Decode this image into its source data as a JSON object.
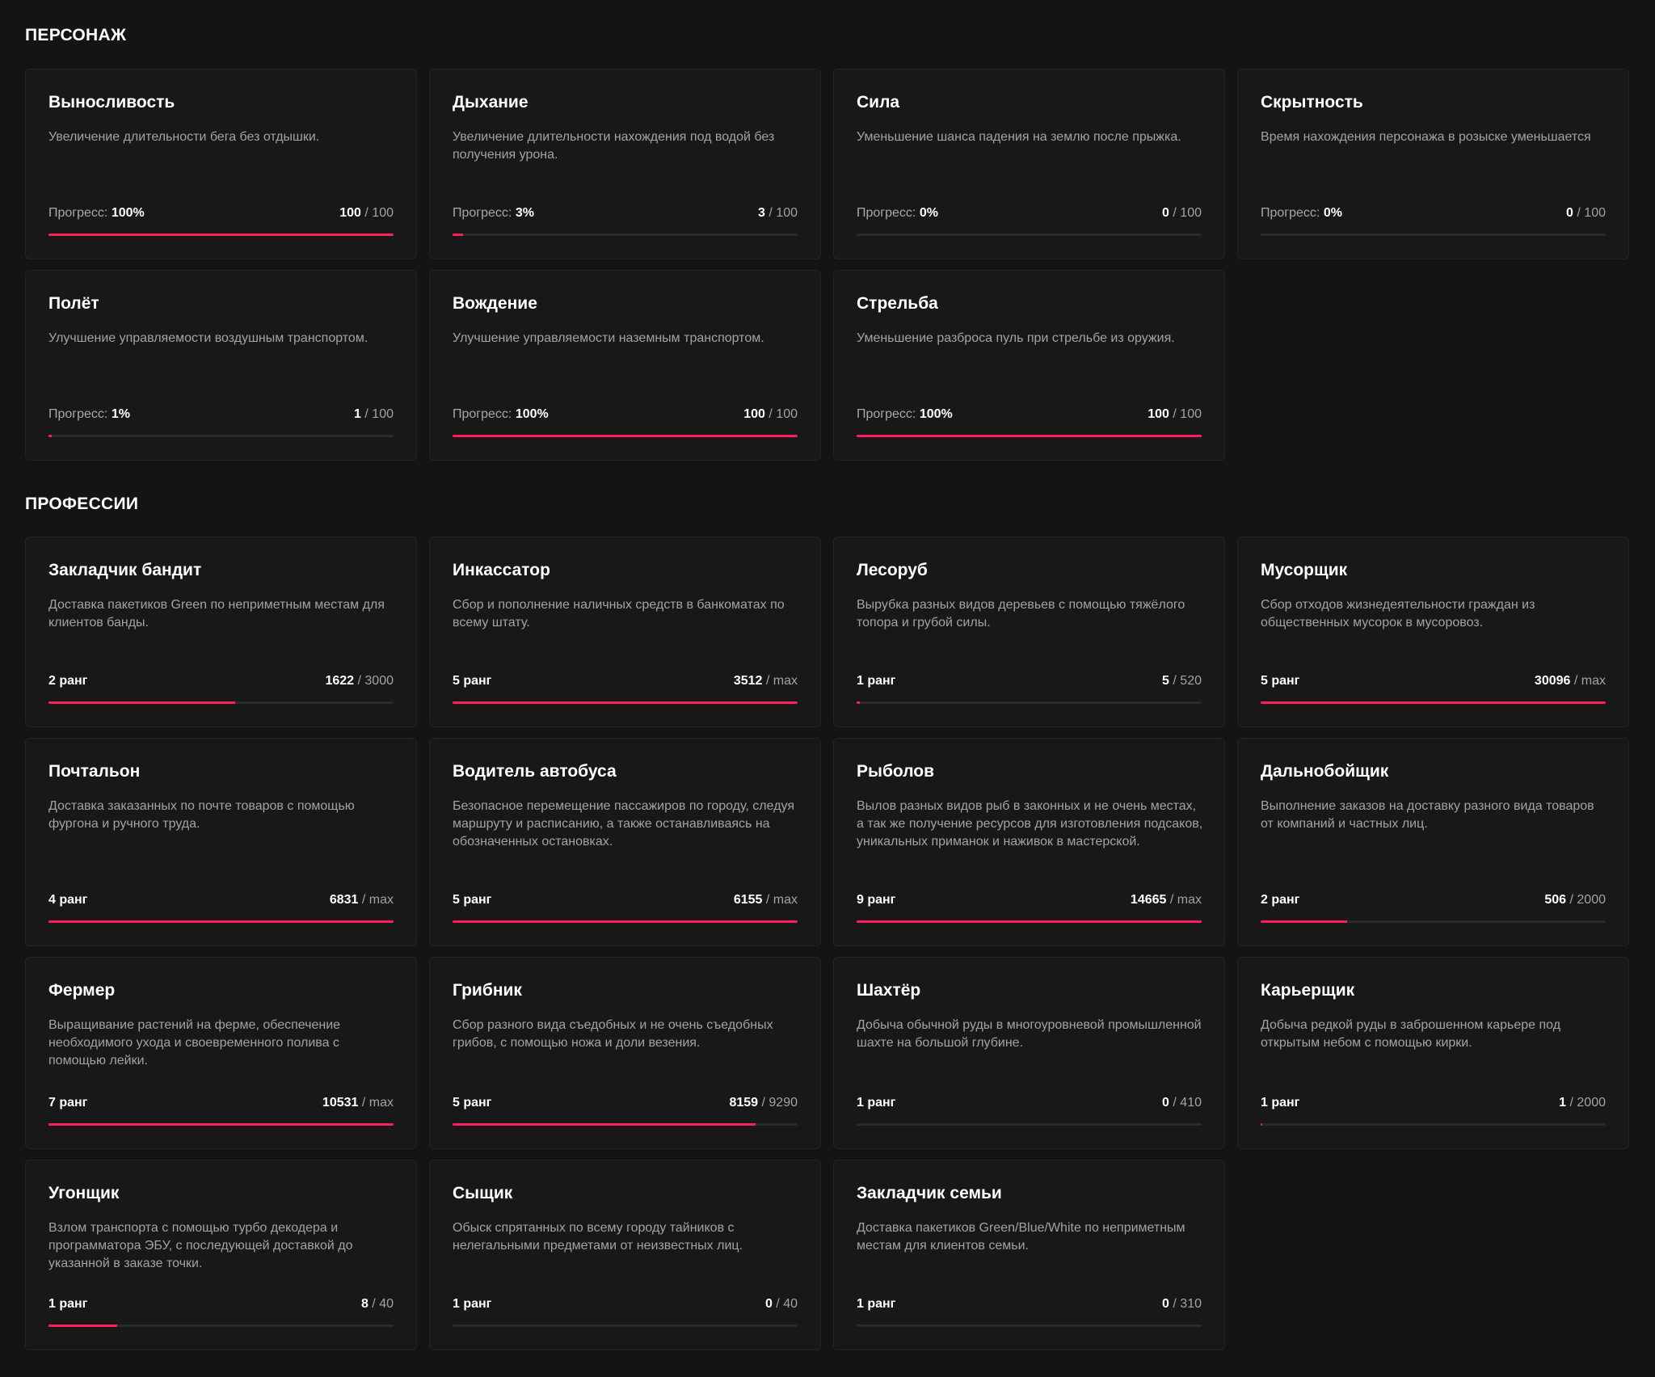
{
  "sections": [
    {
      "title": "ПЕРСОНАЖ",
      "cards": [
        {
          "title": "Выносливость",
          "desc": "Увеличение длительности бега без отдышки.",
          "label": "Прогресс:",
          "left_value": "100%",
          "current": "100",
          "total": "100",
          "fill": 1.0
        },
        {
          "title": "Дыхание",
          "desc": "Увеличение длительности нахождения под водой без получения урона.",
          "label": "Прогресс:",
          "left_value": "3%",
          "current": "3",
          "total": "100",
          "fill": 0.03
        },
        {
          "title": "Сила",
          "desc": "Уменьшение шанса падения на землю после прыжка.",
          "label": "Прогресс:",
          "left_value": "0%",
          "current": "0",
          "total": "100",
          "fill": 0
        },
        {
          "title": "Скрытность",
          "desc": "Время нахождения персонажа в розыске уменьшается",
          "label": "Прогресс:",
          "left_value": "0%",
          "current": "0",
          "total": "100",
          "fill": 0
        },
        {
          "title": "Полёт",
          "desc": "Улучшение управляемости воздушным транспортом.",
          "label": "Прогресс:",
          "left_value": "1%",
          "current": "1",
          "total": "100",
          "fill": 0.01
        },
        {
          "title": "Вождение",
          "desc": "Улучшение управляемости наземным транспортом.",
          "label": "Прогресс:",
          "left_value": "100%",
          "current": "100",
          "total": "100",
          "fill": 1.0
        },
        {
          "title": "Стрельба",
          "desc": "Уменьшение разброса пуль при стрельбе из оружия.",
          "label": "Прогресс:",
          "left_value": "100%",
          "current": "100",
          "total": "100",
          "fill": 1.0
        }
      ]
    },
    {
      "title": "ПРОФЕССИИ",
      "cards": [
        {
          "title": "Закладчик бандит",
          "desc": "Доставка пакетиков Green по неприметным местам для клиентов банды.",
          "label": "",
          "left_value": "2 ранг",
          "current": "1622",
          "total": "3000",
          "fill": 0.54
        },
        {
          "title": "Инкассатор",
          "desc": "Сбор и пополнение наличных средств в банкоматах по всему штату.",
          "label": "",
          "left_value": "5 ранг",
          "current": "3512",
          "total": "max",
          "fill": 1.0
        },
        {
          "title": "Лесоруб",
          "desc": "Вырубка разных видов деревьев с помощью тяжёлого топора и грубой силы.",
          "label": "",
          "left_value": "1 ранг",
          "current": "5",
          "total": "520",
          "fill": 0.01
        },
        {
          "title": "Мусорщик",
          "desc": "Сбор отходов жизнедеятельности граждан из общественных мусорок в мусоровоз.",
          "label": "",
          "left_value": "5 ранг",
          "current": "30096",
          "total": "max",
          "fill": 1.0
        },
        {
          "title": "Почтальон",
          "desc": "Доставка заказанных по почте товаров с помощью фургона и ручного труда.",
          "label": "",
          "left_value": "4 ранг",
          "current": "6831",
          "total": "max",
          "fill": 1.0
        },
        {
          "title": "Водитель автобуса",
          "desc": "Безопасное перемещение пассажиров по городу, следуя маршруту и расписанию, а также останавливаясь на обозначенных остановках.",
          "label": "",
          "left_value": "5 ранг",
          "current": "6155",
          "total": "max",
          "fill": 1.0
        },
        {
          "title": "Рыболов",
          "desc": "Вылов разных видов рыб в законных и не очень местах, а так же получение ресурсов для изготовления подсаков, уникальных приманок и наживок в мастерской.",
          "label": "",
          "left_value": "9 ранг",
          "current": "14665",
          "total": "max",
          "fill": 1.0
        },
        {
          "title": "Дальнобойщик",
          "desc": "Выполнение заказов на доставку разного вида товаров от компаний и частных лиц.",
          "label": "",
          "left_value": "2 ранг",
          "current": "506",
          "total": "2000",
          "fill": 0.25
        },
        {
          "title": "Фермер",
          "desc": "Выращивание растений на ферме, обеспечение необходимого ухода и своевременного полива с помощью лейки.",
          "label": "",
          "left_value": "7 ранг",
          "current": "10531",
          "total": "max",
          "fill": 1.0
        },
        {
          "title": "Грибник",
          "desc": "Сбор разного вида съедобных и не очень съедобных грибов, с помощью ножа и доли везения.",
          "label": "",
          "left_value": "5 ранг",
          "current": "8159",
          "total": "9290",
          "fill": 0.878
        },
        {
          "title": "Шахтёр",
          "desc": "Добыча обычной руды в многоуровневой промышленной шахте на большой глубине.",
          "label": "",
          "left_value": "1 ранг",
          "current": "0",
          "total": "410",
          "fill": 0
        },
        {
          "title": "Карьерщик",
          "desc": "Добыча редкой руды в заброшенном карьере под открытым небом с помощью кирки.",
          "label": "",
          "left_value": "1 ранг",
          "current": "1",
          "total": "2000",
          "fill": 0.0005
        },
        {
          "title": "Угонщик",
          "desc": "Взлом транспорта с помощью турбо декодера и программатора ЭБУ, с последующей доставкой до указанной в заказе точки.",
          "label": "",
          "left_value": "1 ранг",
          "current": "8",
          "total": "40",
          "fill": 0.2
        },
        {
          "title": "Сыщик",
          "desc": "Обыск спрятанных по всему городу тайников с нелегальными предметами от неизвестных лиц.",
          "label": "",
          "left_value": "1 ранг",
          "current": "0",
          "total": "40",
          "fill": 0
        },
        {
          "title": "Закладчик семьи",
          "desc": "Доставка пакетиков Green/Blue/White по неприметным местам для клиентов семьи.",
          "label": "",
          "left_value": "1 ранг",
          "current": "0",
          "total": "310",
          "fill": 0
        }
      ]
    }
  ],
  "colors": {
    "accent": "#ff1f5a",
    "background": "#141414",
    "card": "#181818"
  }
}
